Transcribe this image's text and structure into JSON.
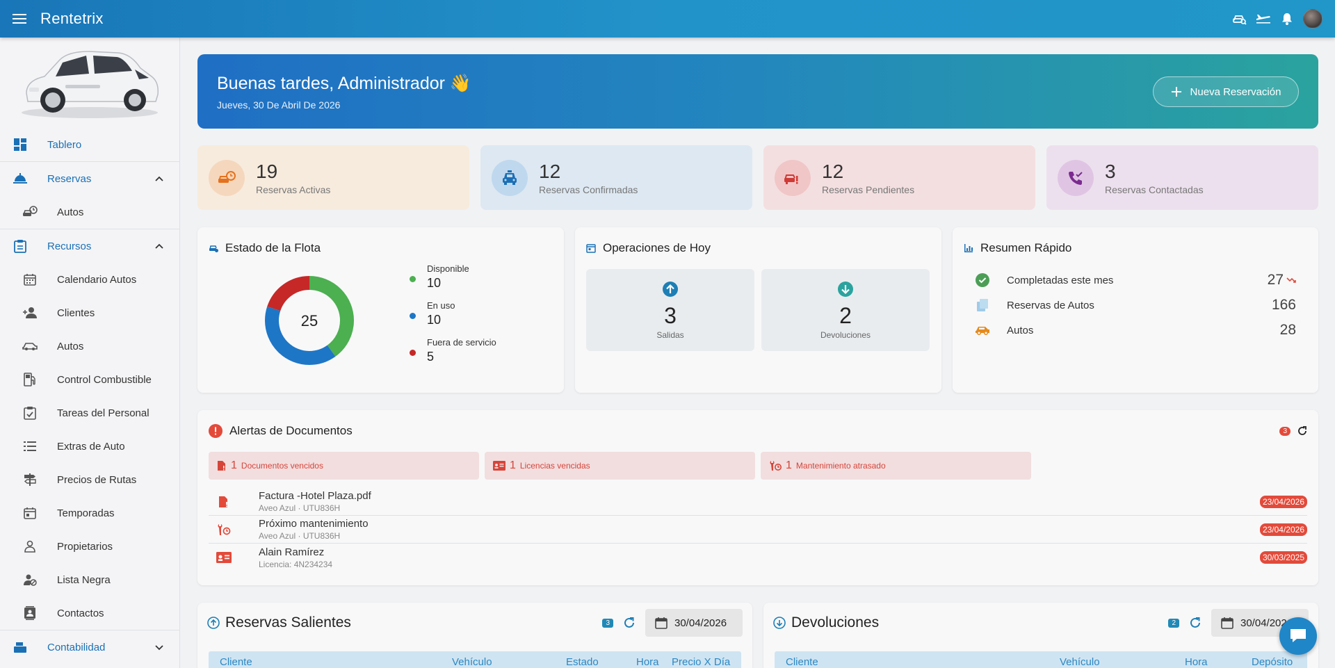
{
  "app": {
    "title": "Rentetrix"
  },
  "sidebar": {
    "items": [
      {
        "label": "Tablero"
      },
      {
        "label": "Reservas"
      },
      {
        "label": "Autos"
      },
      {
        "label": "Recursos"
      },
      {
        "label": "Calendario Autos"
      },
      {
        "label": "Clientes"
      },
      {
        "label": "Autos"
      },
      {
        "label": "Control Combustible"
      },
      {
        "label": "Tareas del Personal"
      },
      {
        "label": "Extras de Auto"
      },
      {
        "label": "Precios de Rutas"
      },
      {
        "label": "Temporadas"
      },
      {
        "label": "Propietarios"
      },
      {
        "label": "Lista Negra"
      },
      {
        "label": "Contactos"
      },
      {
        "label": "Contabilidad"
      }
    ]
  },
  "hero": {
    "greeting": "Buenas tardes, Administrador 👋",
    "date": "Jueves, 30 De Abril De 2026",
    "new_button": "Nueva Reservación"
  },
  "stats": [
    {
      "value": "19",
      "label": "Reservas Activas"
    },
    {
      "value": "12",
      "label": "Reservas Confirmadas"
    },
    {
      "value": "12",
      "label": "Reservas Pendientes"
    },
    {
      "value": "3",
      "label": "Reservas Contactadas"
    }
  ],
  "fleet": {
    "title": "Estado de la Flota",
    "total": "25",
    "items": [
      {
        "label": "Disponible",
        "value": "10",
        "color": "#4caf50"
      },
      {
        "label": "En uso",
        "value": "10",
        "color": "#1e76c6"
      },
      {
        "label": "Fuera de servicio",
        "value": "5",
        "color": "#c62828"
      }
    ]
  },
  "ops": {
    "title": "Operaciones de Hoy",
    "out": {
      "value": "3",
      "label": "Salidas"
    },
    "in": {
      "value": "2",
      "label": "Devoluciones"
    }
  },
  "summary": {
    "title": "Resumen Rápido",
    "rows": [
      {
        "label": "Completadas este mes",
        "value": "27"
      },
      {
        "label": "Reservas de Autos",
        "value": "166"
      },
      {
        "label": "Autos",
        "value": "28"
      }
    ]
  },
  "alerts": {
    "title": "Alertas de Documentos",
    "count": "3",
    "chips": [
      {
        "count": "1",
        "label": "Documentos vencidos"
      },
      {
        "count": "1",
        "label": "Licencias vencidas"
      },
      {
        "count": "1",
        "label": "Mantenimiento atrasado"
      }
    ],
    "rows": [
      {
        "title": "Factura -Hotel Plaza.pdf",
        "sub": "Aveo Azul · UTU836H",
        "date": "23/04/2026"
      },
      {
        "title": "Próximo mantenimiento",
        "sub": "Aveo Azul · UTU836H",
        "date": "23/04/2026"
      },
      {
        "title": "Alain Ramírez",
        "sub": "Licencia: 4N234234",
        "date": "30/03/2025"
      }
    ]
  },
  "outgoing": {
    "title": "Reservas Salientes",
    "count": "3",
    "date": "30/04/2026",
    "columns": [
      "Cliente",
      "Vehículo",
      "Estado",
      "Hora",
      "Precio X Día"
    ]
  },
  "returns": {
    "title": "Devoluciones",
    "count": "2",
    "date": "30/04/2026",
    "columns": [
      "Cliente",
      "Vehículo",
      "Hora",
      "Depósito"
    ]
  },
  "colors": {
    "accent": "#2293c9",
    "danger": "#e34a3a"
  }
}
